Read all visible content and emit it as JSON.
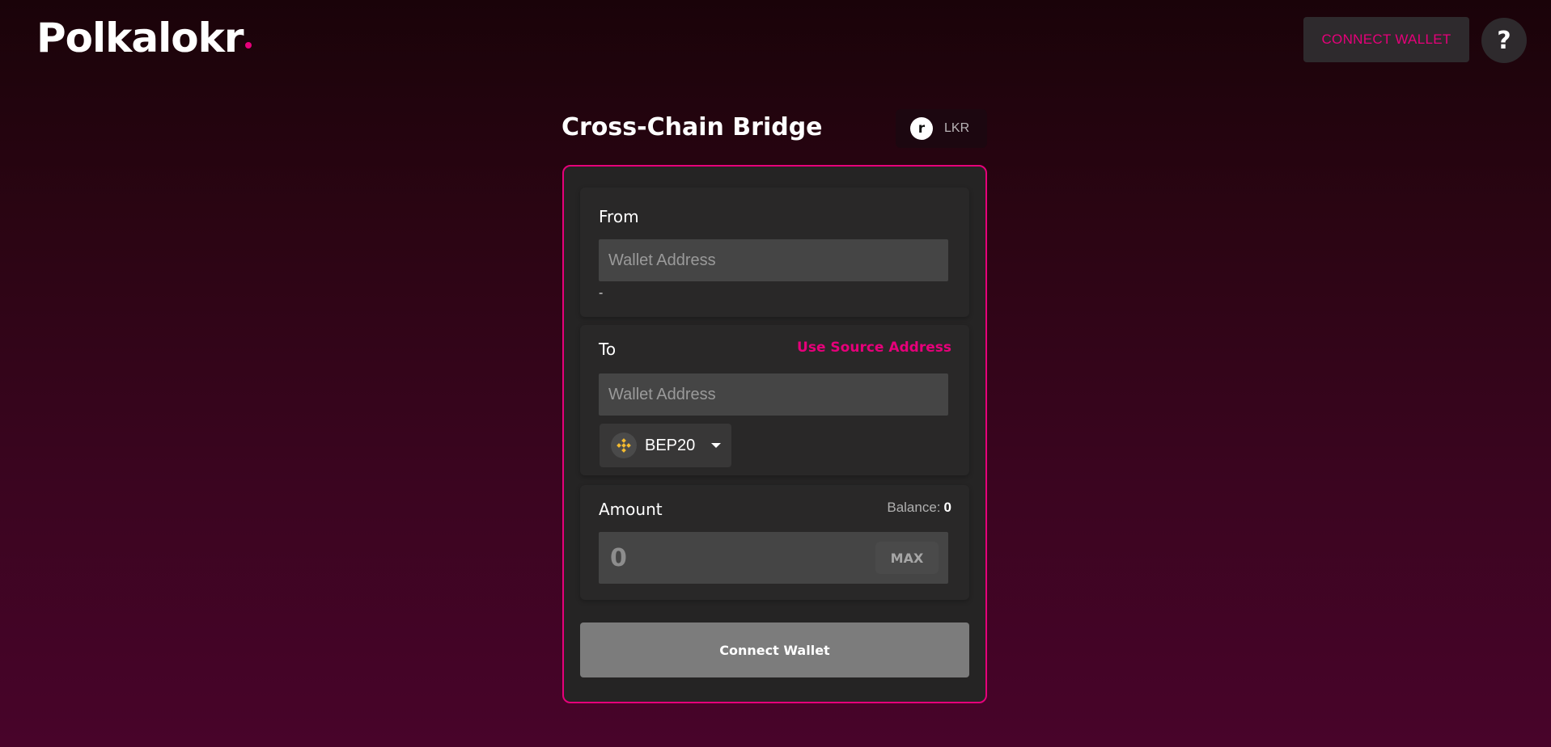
{
  "header": {
    "logo_text": "Polkalokr",
    "connect_wallet_label": "CONNECT WALLET",
    "help_label": "?"
  },
  "bridge": {
    "title": "Cross-Chain Bridge",
    "token": {
      "icon_letter": "r",
      "label": "LKR"
    }
  },
  "from": {
    "label": "From",
    "placeholder": "Wallet Address",
    "value": "",
    "sub_text": "-"
  },
  "to": {
    "label": "To",
    "use_source_label": "Use Source Address",
    "placeholder": "Wallet Address",
    "value": "",
    "network": {
      "label": "BEP20",
      "icon": "bnb-icon"
    }
  },
  "amount": {
    "label": "Amount",
    "balance_label": "Balance:",
    "balance_value": "0",
    "placeholder": "0",
    "max_label": "MAX"
  },
  "submit_label": "Connect Wallet",
  "colors": {
    "accent": "#e6007a",
    "card_bg": "#252424",
    "button_disabled": "#7c7c7c"
  }
}
